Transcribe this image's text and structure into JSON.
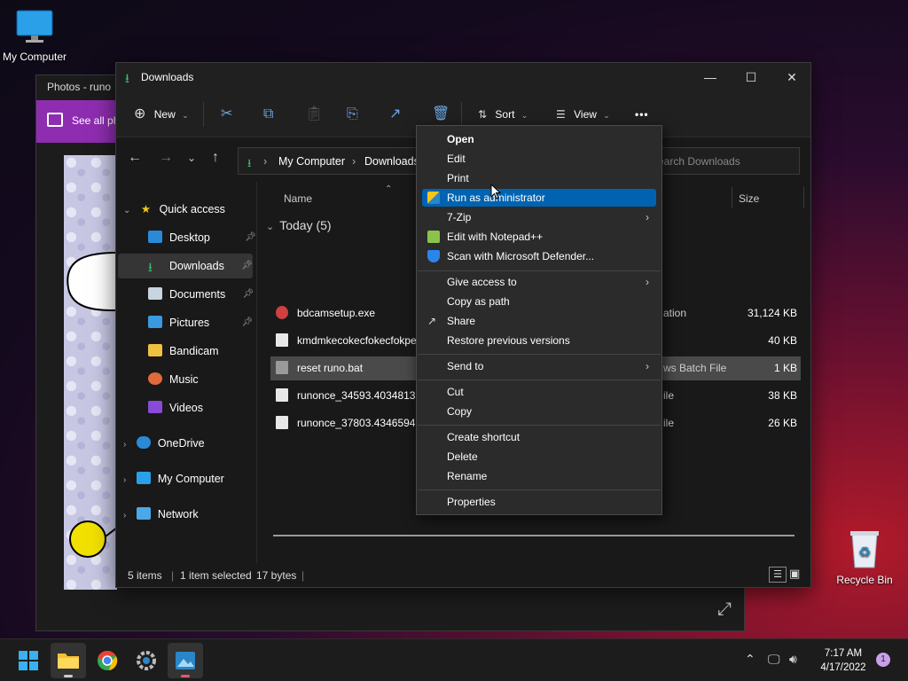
{
  "desktop": {
    "icons": [
      {
        "label": "My Computer"
      },
      {
        "label": "Recycle Bin"
      }
    ]
  },
  "photos": {
    "title": "Photos - runo",
    "see_all": "See all ph"
  },
  "explorer": {
    "title": "Downloads",
    "toolbar": {
      "new_label": "New",
      "sort_label": "Sort",
      "view_label": "View",
      "more_label": "•••"
    },
    "address": {
      "crumbs": [
        "My Computer",
        "Downloads"
      ],
      "search_placeholder": "earch Downloads"
    },
    "sidebar": {
      "quick_access": "Quick access",
      "items": [
        {
          "label": "Desktop",
          "icon": "desktop-icon",
          "pinned": true
        },
        {
          "label": "Downloads",
          "icon": "download-icon",
          "pinned": true
        },
        {
          "label": "Documents",
          "icon": "documents-icon",
          "pinned": true
        },
        {
          "label": "Pictures",
          "icon": "pictures-icon",
          "pinned": true
        },
        {
          "label": "Bandicam",
          "icon": "folder-icon",
          "pinned": false
        },
        {
          "label": "Music",
          "icon": "music-icon",
          "pinned": false
        },
        {
          "label": "Videos",
          "icon": "videos-icon",
          "pinned": false
        }
      ],
      "roots": [
        {
          "label": "OneDrive"
        },
        {
          "label": "My Computer"
        },
        {
          "label": "Network"
        }
      ]
    },
    "columns": {
      "name": "Name",
      "size": "Size"
    },
    "group_header": "Today (5)",
    "files": [
      {
        "name": "bdcamsetup.exe",
        "type": "ation",
        "size": "31,124 KB"
      },
      {
        "name": "kmdmkecokecfokecfokpef",
        "type": "",
        "size": "40 KB"
      },
      {
        "name": "reset runo.bat",
        "type": "ws Batch File",
        "size": "1 KB"
      },
      {
        "name": "runonce_34593.4034813605",
        "type": "ile",
        "size": "38 KB"
      },
      {
        "name": "runonce_37803.4346594028",
        "type": "ile",
        "size": "26 KB"
      }
    ],
    "status": {
      "items": "5 items",
      "selected": "1 item selected",
      "size": "17 bytes"
    }
  },
  "context_menu": {
    "items": [
      {
        "label": "Open",
        "bold": true
      },
      {
        "label": "Edit"
      },
      {
        "label": "Print"
      },
      {
        "label": "Run as administrator",
        "highlighted": true
      },
      {
        "label": "7-Zip",
        "submenu": true
      },
      {
        "label": "Edit with Notepad++"
      },
      {
        "label": "Scan with Microsoft Defender..."
      },
      {
        "label": "Give access to",
        "submenu": true
      },
      {
        "label": "Copy as path"
      },
      {
        "label": "Share"
      },
      {
        "label": "Restore previous versions"
      },
      {
        "label": "Send to",
        "submenu": true
      },
      {
        "label": "Cut"
      },
      {
        "label": "Copy"
      },
      {
        "label": "Create shortcut"
      },
      {
        "label": "Delete"
      },
      {
        "label": "Rename"
      },
      {
        "label": "Properties"
      }
    ]
  },
  "taskbar": {
    "time": "7:17 AM",
    "date": "4/17/2022",
    "notification_count": "1"
  },
  "colors": {
    "accent": "#0063b1",
    "photos_bar": "#8e2db0",
    "folder_green": "#3fc16c"
  }
}
